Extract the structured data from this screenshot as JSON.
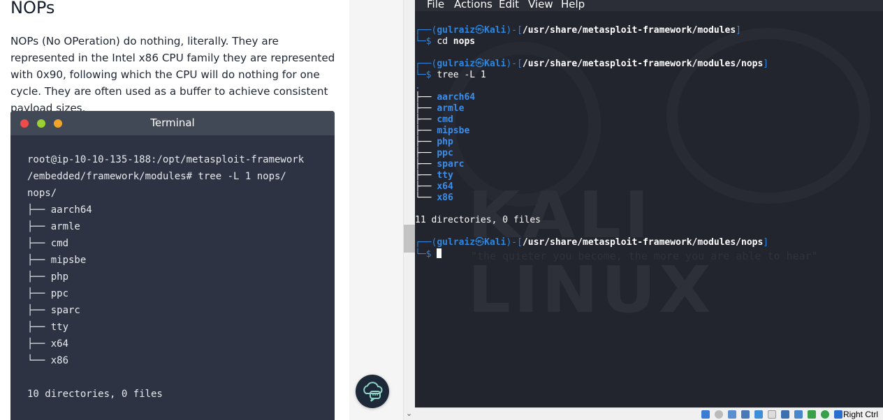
{
  "article": {
    "heading": "NOPs",
    "paragraph": "NOPs (No OPeration) do nothing, literally. They are represented in the Intel x86 CPU family they are represented with 0x90, following which the CPU will do nothing for one cycle. They are often used as a buffer to achieve consistent payload sizes.",
    "terminal": {
      "title": "Terminal",
      "prompt_line1": "root@ip-10-10-135-188:/opt/metasploit-framework",
      "prompt_line2": "/embedded/framework/modules# tree -L 1 nops/",
      "root_dir": "nops/",
      "entries": [
        "├── aarch64",
        "├── armle",
        "├── cmd",
        "├── mipsbe",
        "├── php",
        "├── ppc",
        "├── sparc",
        "├── tty",
        "├── x64",
        "└── x86"
      ],
      "summary": "10 directories, 0 files"
    }
  },
  "vm": {
    "menu": [
      "File",
      "Actions",
      "Edit",
      "View",
      "Help"
    ],
    "watermark": "KALI LINUX",
    "slogan": "\"the quieter you become, the more you are able to hear\"",
    "prompts": [
      {
        "user": "gulraiz",
        "host": "Kali",
        "path": "/usr/share/metasploit-framework/modules",
        "command": "cd ",
        "arg": "nops"
      },
      {
        "user": "gulraiz",
        "host": "Kali",
        "path": "/usr/share/metasploit-framework/modules/nops",
        "command": "tree -L 1",
        "arg": ""
      },
      {
        "user": "gulraiz",
        "host": "Kali",
        "path": "/usr/share/metasploit-framework/modules/nops",
        "command": "",
        "arg": ""
      }
    ],
    "tree_root": ".",
    "tree": [
      "aarch64",
      "armle",
      "cmd",
      "mipsbe",
      "php",
      "ppc",
      "sparc",
      "tty",
      "x64",
      "x86"
    ],
    "summary": "11 directories, 0 files",
    "status_right": "Right Ctrl"
  },
  "colors": {
    "prompt_blue": "#2e86de",
    "term_bg": "#23252e",
    "article_term_bg": "#2d3343",
    "chat_btn": "#1d2839"
  },
  "icons": {
    "chat": "chat-bubble-cloud-icon",
    "status": [
      "hdd-icon",
      "cd-icon",
      "audio-icon",
      "network-icon",
      "pen-icon",
      "display-icon",
      "shared-folder-icon",
      "recording-icon",
      "mouse-icon",
      "keyboard-icon",
      "arrow-down-icon"
    ]
  }
}
